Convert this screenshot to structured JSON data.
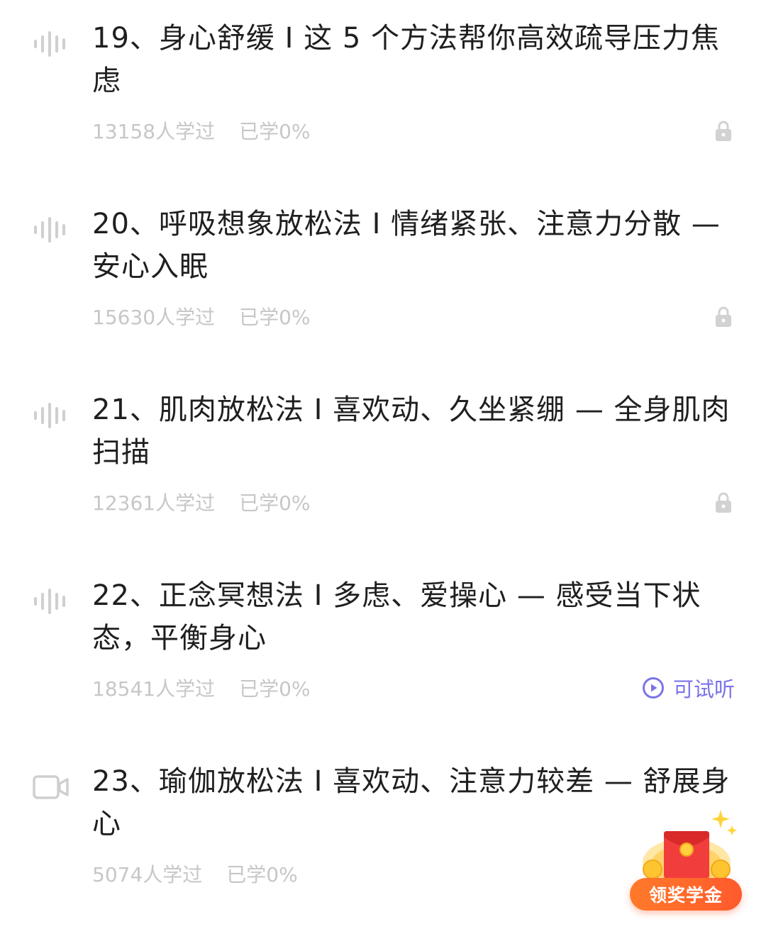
{
  "lessons": [
    {
      "type": "audio",
      "title": "19、身心舒缓 I 这 5 个方法帮你高效疏导压力焦虑",
      "learners": "13158人学过",
      "progress": "已学0%",
      "status": "locked"
    },
    {
      "type": "audio",
      "title": "20、呼吸想象放松法 I 情绪紧张、注意力分散 — 安心入眠",
      "learners": "15630人学过",
      "progress": "已学0%",
      "status": "locked"
    },
    {
      "type": "audio",
      "title": "21、肌肉放松法 I 喜欢动、久坐紧绷 — 全身肌肉扫描",
      "learners": "12361人学过",
      "progress": "已学0%",
      "status": "locked"
    },
    {
      "type": "audio",
      "title": "22、正念冥想法 I 多虑、爱操心 — 感受当下状态，平衡身心",
      "learners": "18541人学过",
      "progress": "已学0%",
      "status": "trial",
      "trial_label": "可试听"
    },
    {
      "type": "video",
      "title": "23、瑜伽放松法 I 喜欢动、注意力较差 — 舒展身心",
      "learners": "5074人学过",
      "progress": "已学0%",
      "status": "none"
    }
  ],
  "reward_button": {
    "label": "领奖学金"
  },
  "colors": {
    "title": "#1f1f1f",
    "meta": "#c7c7c7",
    "trial": "#7b74e8",
    "reward": "#ff5a2c"
  }
}
